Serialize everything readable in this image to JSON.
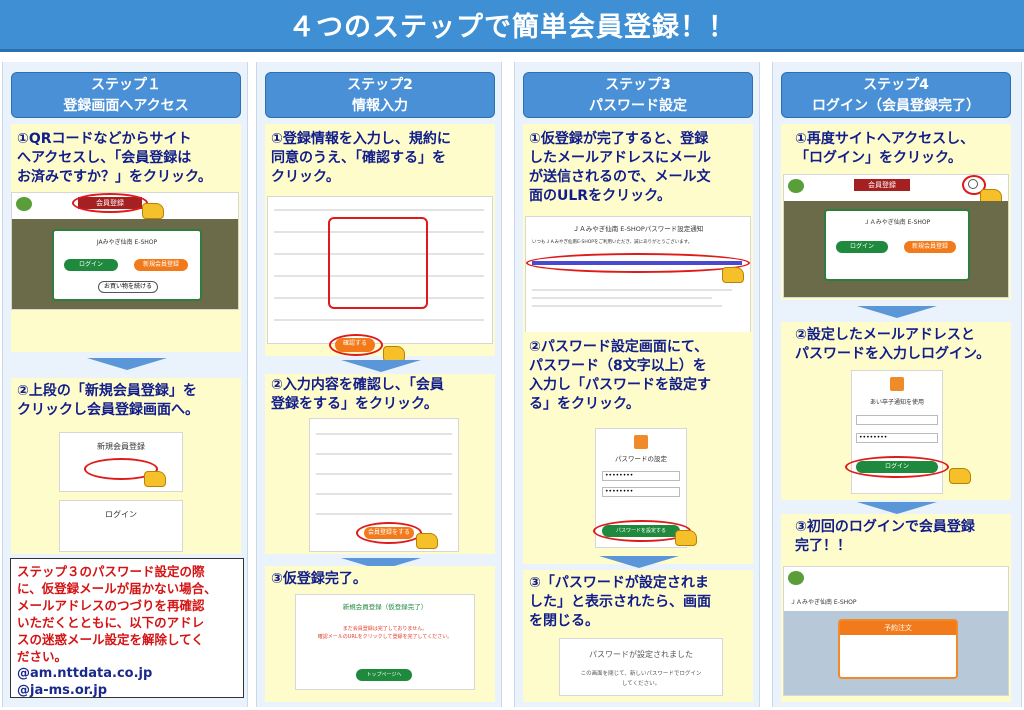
{
  "title": "４つのステップで簡単会員登録！！",
  "steps": [
    {
      "head1": "ステップ１",
      "head2": "登録画面へアクセス",
      "p1": [
        "①QRコードなどからサイト",
        "へアクセスし、「会員登録は",
        "お済みですか？」をクリック。"
      ],
      "p2": [
        "②上段の「新規会員登録」を",
        "クリックし会員登録画面へ。"
      ],
      "shot1": {
        "badge": "会員登録",
        "site": "JAみやぎ仙南 E-SHOP",
        "login": "ログイン",
        "register": "新規会員登録",
        "guest": "お買い物を続ける"
      },
      "shot2": {
        "new_reg": "新規会員登録",
        "login": "ログイン"
      }
    },
    {
      "head1": "ステップ2",
      "head2": "情報入力",
      "p1": [
        "①登録情報を入力し、規約に",
        "同意のうえ、「確認する」を",
        "クリック。"
      ],
      "p2": [
        "②入力内容を確認し、「会員",
        "登録をする」をクリック。"
      ],
      "p3": "③仮登録完了。",
      "shot1": {
        "confirm": "確認する"
      },
      "shot2": {
        "submit": "会員登録をする"
      },
      "shot3": {
        "heading": "新規会員登録（仮登録完了）",
        "line1": "まだ会員登録は完了しておりません。",
        "line2": "確認メールのURLをクリックして登録を完了してください。",
        "button": "トップページへ"
      }
    },
    {
      "head1": "ステップ3",
      "head2": "パスワード設定",
      "p1": [
        "①仮登録が完了すると、登録",
        "したメールアドレスにメール",
        "が送信されるので、メール文",
        "面のULRをクリック。"
      ],
      "p2": [
        "②パスワード設定画面にて、",
        "パスワード（8文字以上）を",
        "入力し「パスワードを設定す",
        "る」をクリック。"
      ],
      "p3": [
        "③「パスワードが設定されま",
        "した」と表示されたら、画面",
        "を閉じる。"
      ],
      "mail": {
        "subject": "ＪＡみやぎ仙南 E-SHOPパスワード設定通知",
        "body": "いつもＪＡみやぎ仙南E-SHOPをご利用いただき、誠にありがとうございます。"
      },
      "pwform": {
        "title": "パスワードの設定",
        "button": "パスワードを設定する"
      },
      "done": {
        "line1": "パスワードが設定されました",
        "line2": "この画面を閉じて、新しいパスワードでログイン",
        "line3": "してください。"
      }
    },
    {
      "head1": "ステップ4",
      "head2": "ログイン（会員登録完了）",
      "p1": [
        "①再度サイトへアクセスし、",
        "「ログイン」をクリック。"
      ],
      "p2": [
        "②設定したメールアドレスと",
        "パスワードを入力しログイン。"
      ],
      "p3": [
        "③初回のログインで会員登録",
        "完了！！"
      ],
      "shot1": {
        "badge": "会員登録",
        "site": "ＪＡみやぎ仙南 E-SHOP",
        "login": "ログイン",
        "register": "新規会員登録"
      },
      "shot2": {
        "title": "あい卒子通知を使用",
        "button": "ログイン"
      },
      "shot3": {
        "site": "ＪＡみやぎ仙南 E-SHOP",
        "order": "予約注文"
      }
    }
  ],
  "warning": {
    "lines": [
      "ステップ３のパスワード設定の際",
      "に、仮登録メールが届かない場合、",
      "メールアドレスのつづりを再確認",
      "いただくとともに、以下のアドレ",
      "スの迷惑メール設定を解除してく",
      "ださい。"
    ],
    "mails": [
      "@am.nttdata.co.jp",
      "@ja-ms.or.jp"
    ]
  },
  "colors": {
    "banner": "#3e8fd3",
    "panel": "#fffccc",
    "stephead": "#4a90d6",
    "text": "#111d8a",
    "warning": "#d41414"
  }
}
